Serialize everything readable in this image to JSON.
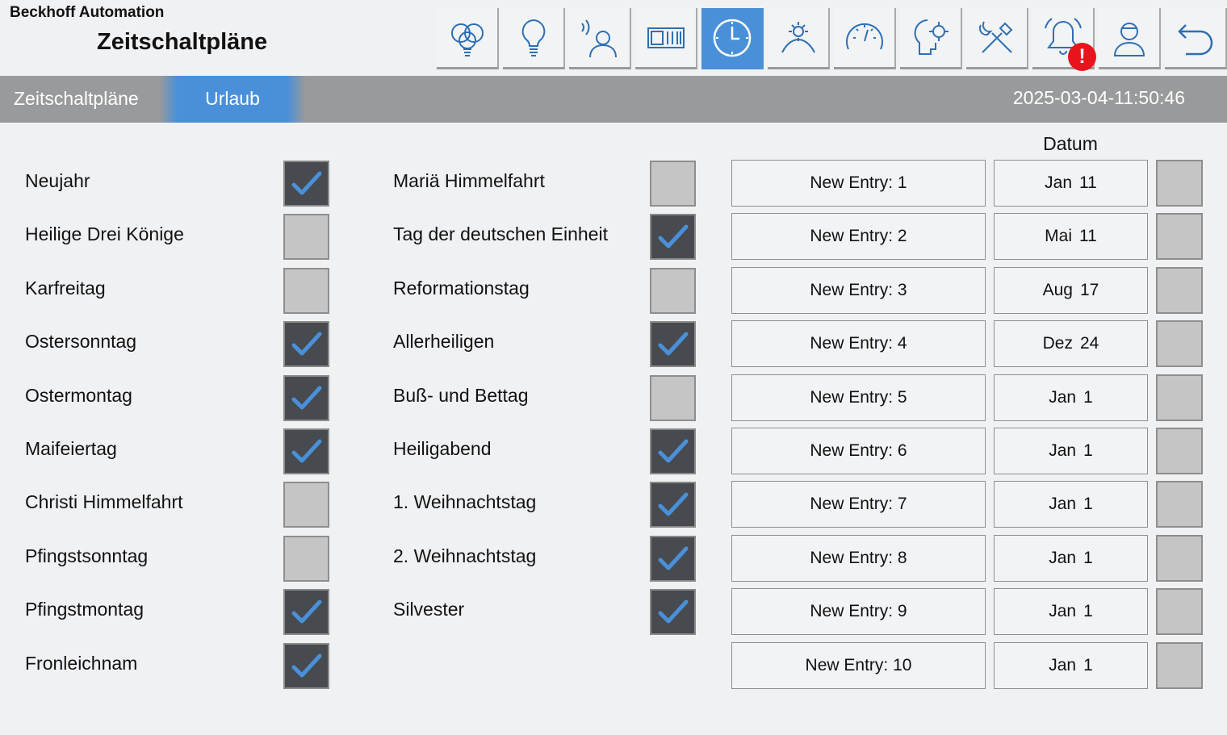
{
  "header": {
    "company": "Beckhoff Automation",
    "title": "Zeitschaltpläne"
  },
  "toolbar": {
    "buttons": [
      {
        "icon": "bulbs-icon",
        "active": false
      },
      {
        "icon": "bulb-icon",
        "active": false
      },
      {
        "icon": "presence-person-icon",
        "active": false
      },
      {
        "icon": "blinds-icon",
        "active": false
      },
      {
        "icon": "clock-icon",
        "active": true
      },
      {
        "icon": "weather-icon",
        "active": false
      },
      {
        "icon": "gauge-icon",
        "active": false
      },
      {
        "icon": "settings-head-icon",
        "active": false
      },
      {
        "icon": "tools-icon",
        "active": false
      },
      {
        "icon": "alarm-bell-icon",
        "active": false,
        "badge": "!"
      },
      {
        "icon": "user-icon",
        "active": false
      },
      {
        "icon": "back-arrow-icon",
        "active": false
      }
    ],
    "accent_color": "#4a90d9",
    "alarm_color": "#e8141c"
  },
  "tabs": [
    {
      "label": "Zeitschaltpläne",
      "active": false
    },
    {
      "label": "Urlaub",
      "active": true
    }
  ],
  "datetime": "2025-03-04-11:50:46",
  "holidays_left": [
    {
      "label": "Neujahr",
      "checked": true
    },
    {
      "label": "Heilige Drei Könige",
      "checked": false
    },
    {
      "label": "Karfreitag",
      "checked": false
    },
    {
      "label": "Ostersonntag",
      "checked": true
    },
    {
      "label": "Ostermontag",
      "checked": true
    },
    {
      "label": "Maifeiertag",
      "checked": true
    },
    {
      "label": "Christi Himmelfahrt",
      "checked": false
    },
    {
      "label": "Pfingstsonntag",
      "checked": false
    },
    {
      "label": "Pfingstmontag",
      "checked": true
    },
    {
      "label": "Fronleichnam",
      "checked": true
    }
  ],
  "holidays_right": [
    {
      "label": "Mariä Himmelfahrt",
      "checked": false
    },
    {
      "label": "Tag der deutschen Einheit",
      "checked": true
    },
    {
      "label": "Reformationstag",
      "checked": false
    },
    {
      "label": "Allerheiligen",
      "checked": true
    },
    {
      "label": "Buß- und Bettag",
      "checked": false
    },
    {
      "label": "Heiligabend",
      "checked": true
    },
    {
      "label": "1. Weihnachtstag",
      "checked": true
    },
    {
      "label": "2. Weihnachtstag",
      "checked": true
    },
    {
      "label": "Silvester",
      "checked": true
    }
  ],
  "datum_header": "Datum",
  "entries": [
    {
      "name": "New Entry: 1",
      "month": "Jan",
      "day": "11"
    },
    {
      "name": "New Entry: 2",
      "month": "Mai",
      "day": "11"
    },
    {
      "name": "New Entry: 3",
      "month": "Aug",
      "day": "17"
    },
    {
      "name": "New Entry: 4",
      "month": "Dez",
      "day": "24"
    },
    {
      "name": "New Entry: 5",
      "month": "Jan",
      "day": "1"
    },
    {
      "name": "New Entry: 6",
      "month": "Jan",
      "day": "1"
    },
    {
      "name": "New Entry: 7",
      "month": "Jan",
      "day": "1"
    },
    {
      "name": "New Entry: 8",
      "month": "Jan",
      "day": "1"
    },
    {
      "name": "New Entry: 9",
      "month": "Jan",
      "day": "1"
    },
    {
      "name": "New Entry: 10",
      "month": "Jan",
      "day": "1"
    }
  ]
}
